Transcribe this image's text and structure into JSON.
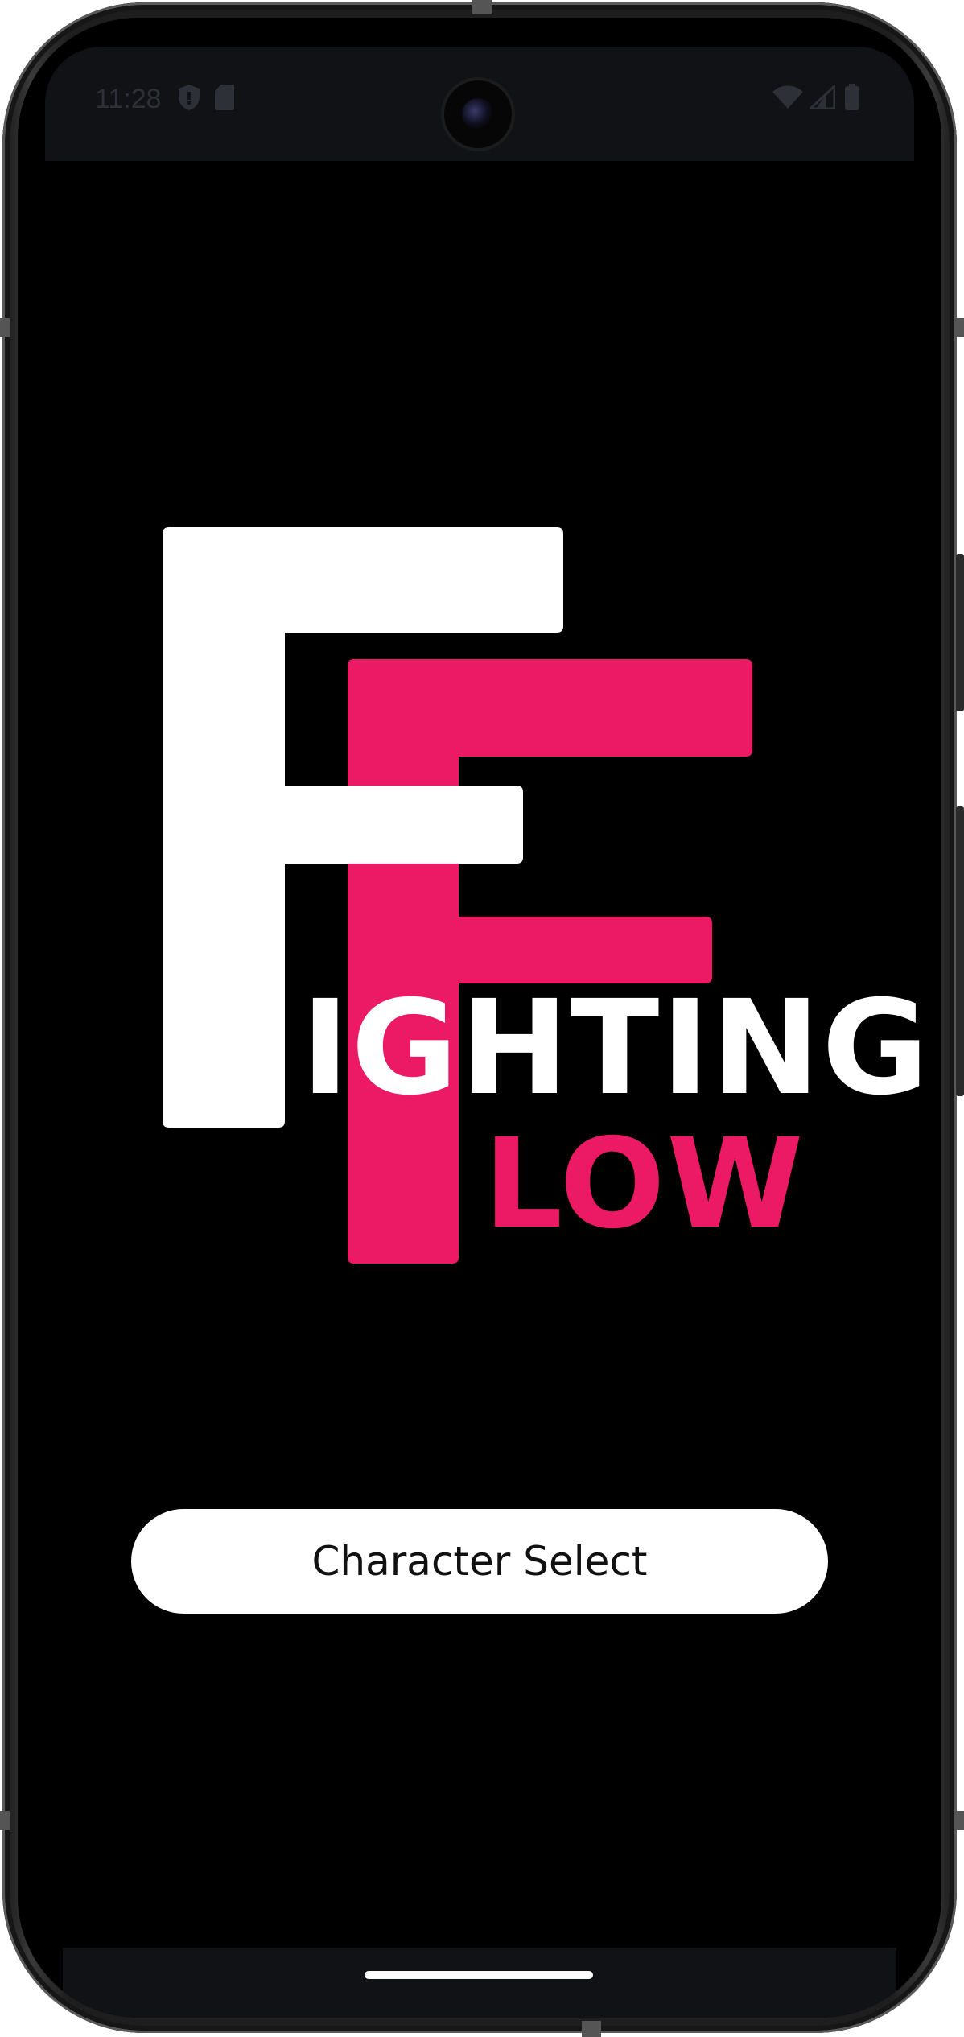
{
  "status_bar": {
    "time": "11:28",
    "left_icons": [
      "shield-icon",
      "sd-card-icon"
    ],
    "right_icons": [
      "wifi-icon",
      "signal-icon",
      "battery-icon"
    ]
  },
  "logo": {
    "primary_letter": "F",
    "secondary_letter": "F",
    "line1_rest": "IGHTING",
    "line2_rest": "LOW",
    "colors": {
      "white": "#FFFFFF",
      "pink": "#EC1A64",
      "background": "#000000"
    }
  },
  "main": {
    "character_select_label": "Character Select"
  }
}
